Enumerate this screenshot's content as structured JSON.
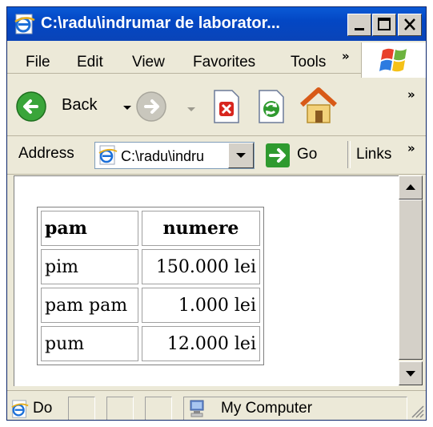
{
  "window": {
    "title": "C:\\radu\\indrumar de laborator...",
    "caption_buttons": [
      "minimize",
      "maximize",
      "close"
    ]
  },
  "menu": {
    "items": [
      "File",
      "Edit",
      "View",
      "Favorites",
      "Tools"
    ],
    "overflow": "»"
  },
  "toolbar": {
    "back_label": "Back",
    "overflow": "»",
    "icons": [
      "back-arrow-icon",
      "forward-arrow-icon",
      "stop-icon",
      "refresh-icon",
      "home-icon"
    ]
  },
  "address": {
    "label": "Address",
    "value": "C:\\radu\\indru",
    "go_label": "Go",
    "links_label": "Links",
    "overflow": "»"
  },
  "table": {
    "headers": [
      "pam",
      "numere"
    ],
    "rows": [
      [
        "pim",
        "150.000 lei"
      ],
      [
        "pam pam",
        "1.000 lei"
      ],
      [
        "pum",
        "12.000 lei"
      ]
    ]
  },
  "status": {
    "text": "Do",
    "zone": "My Computer"
  },
  "colors": {
    "titlebar": "#0a5ad6",
    "chrome": "#ece9d8",
    "go_arrow": "#2f9a2f"
  }
}
